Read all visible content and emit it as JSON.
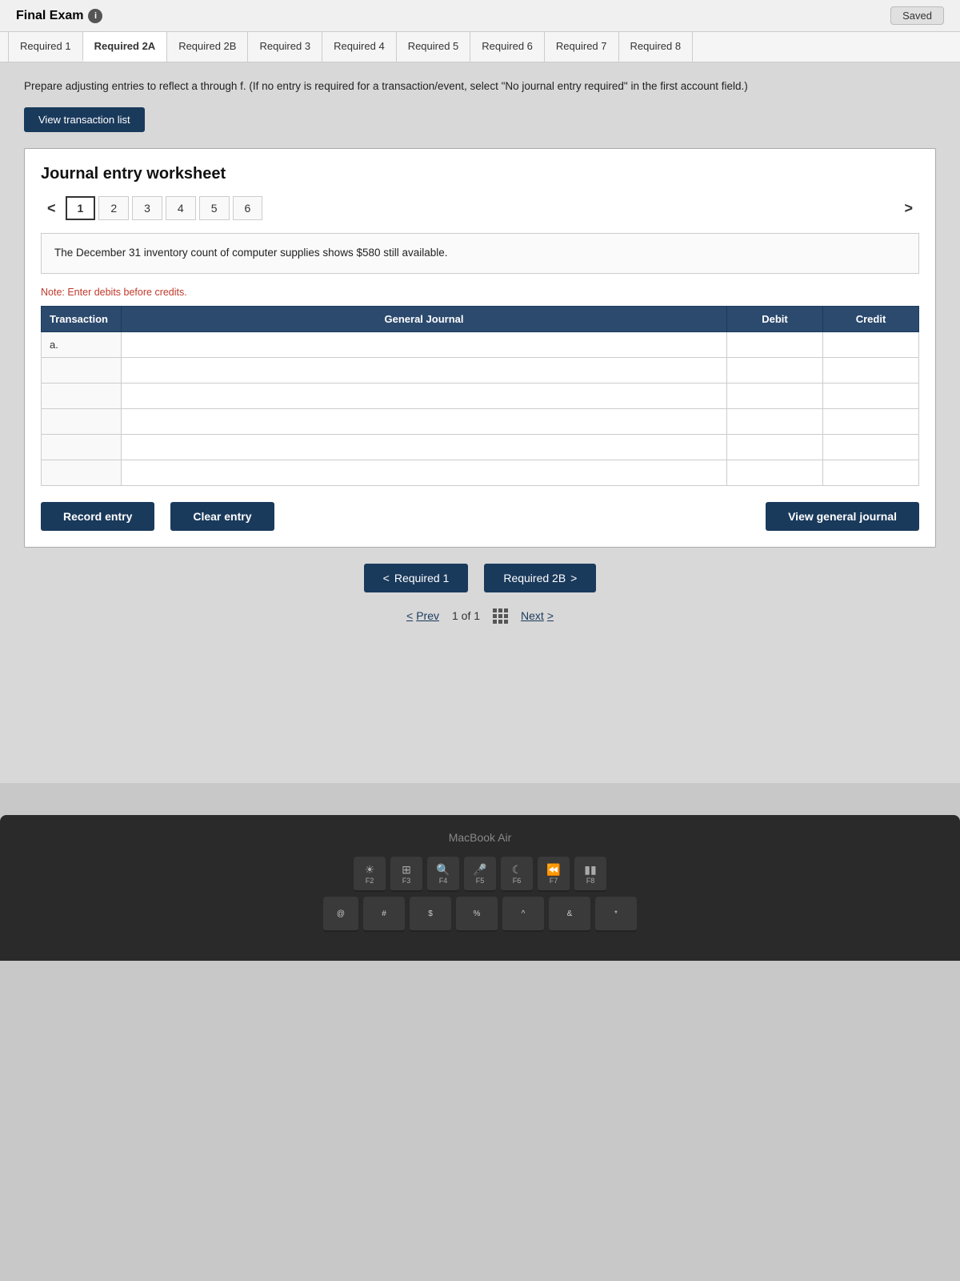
{
  "header": {
    "title": "Final Exam",
    "info_icon": "i",
    "saved_label": "Saved"
  },
  "tabs": [
    {
      "id": "req1",
      "label": "Required 1",
      "active": false
    },
    {
      "id": "req2a",
      "label": "Required 2A",
      "active": true
    },
    {
      "id": "req2b",
      "label": "Required 2B",
      "active": false
    },
    {
      "id": "req3",
      "label": "Required 3",
      "active": false
    },
    {
      "id": "req4",
      "label": "Required 4",
      "active": false
    },
    {
      "id": "req5",
      "label": "Required 5",
      "active": false
    },
    {
      "id": "req6",
      "label": "Required 6",
      "active": false
    },
    {
      "id": "req7",
      "label": "Required 7",
      "active": false
    },
    {
      "id": "req8",
      "label": "Required 8",
      "active": false
    }
  ],
  "instruction": "Prepare adjusting entries to reflect a through f. (If no entry is required for a transaction/event, select \"No journal entry required\" in the first account field.)",
  "view_transaction_btn": "View transaction list",
  "worksheet": {
    "title": "Journal entry worksheet",
    "number_tabs": [
      "1",
      "2",
      "3",
      "4",
      "5",
      "6"
    ],
    "active_tab": "1",
    "description": "The December 31 inventory count of computer supplies shows $580 still available.",
    "note": "Note: Enter debits before credits.",
    "table": {
      "headers": [
        "Transaction",
        "General Journal",
        "Debit",
        "Credit"
      ],
      "rows": [
        {
          "transaction": "a.",
          "journal": "",
          "debit": "",
          "credit": ""
        },
        {
          "transaction": "",
          "journal": "",
          "debit": "",
          "credit": ""
        },
        {
          "transaction": "",
          "journal": "",
          "debit": "",
          "credit": ""
        },
        {
          "transaction": "",
          "journal": "",
          "debit": "",
          "credit": ""
        },
        {
          "transaction": "",
          "journal": "",
          "debit": "",
          "credit": ""
        },
        {
          "transaction": "",
          "journal": "",
          "debit": "",
          "credit": ""
        }
      ]
    },
    "buttons": {
      "record": "Record entry",
      "clear": "Clear entry",
      "view_journal": "View general journal"
    }
  },
  "navigation": {
    "prev_section": "Required 1",
    "next_section": "Required 2B",
    "prev_label": "Prev",
    "page_info": "1 of 1",
    "next_label": "Next"
  },
  "keyboard": {
    "macbook_label": "MacBook Air",
    "fn_row": [
      "F2",
      "F3",
      "F4",
      "F5",
      "F6",
      "F7",
      "F8"
    ],
    "fn_icons": [
      "☀",
      "⊞",
      "🔍",
      "🎤",
      "🌙",
      "◄◄",
      "►║"
    ],
    "char_row": [
      "@",
      "#",
      "$",
      "%",
      "^",
      "&",
      "*"
    ]
  }
}
